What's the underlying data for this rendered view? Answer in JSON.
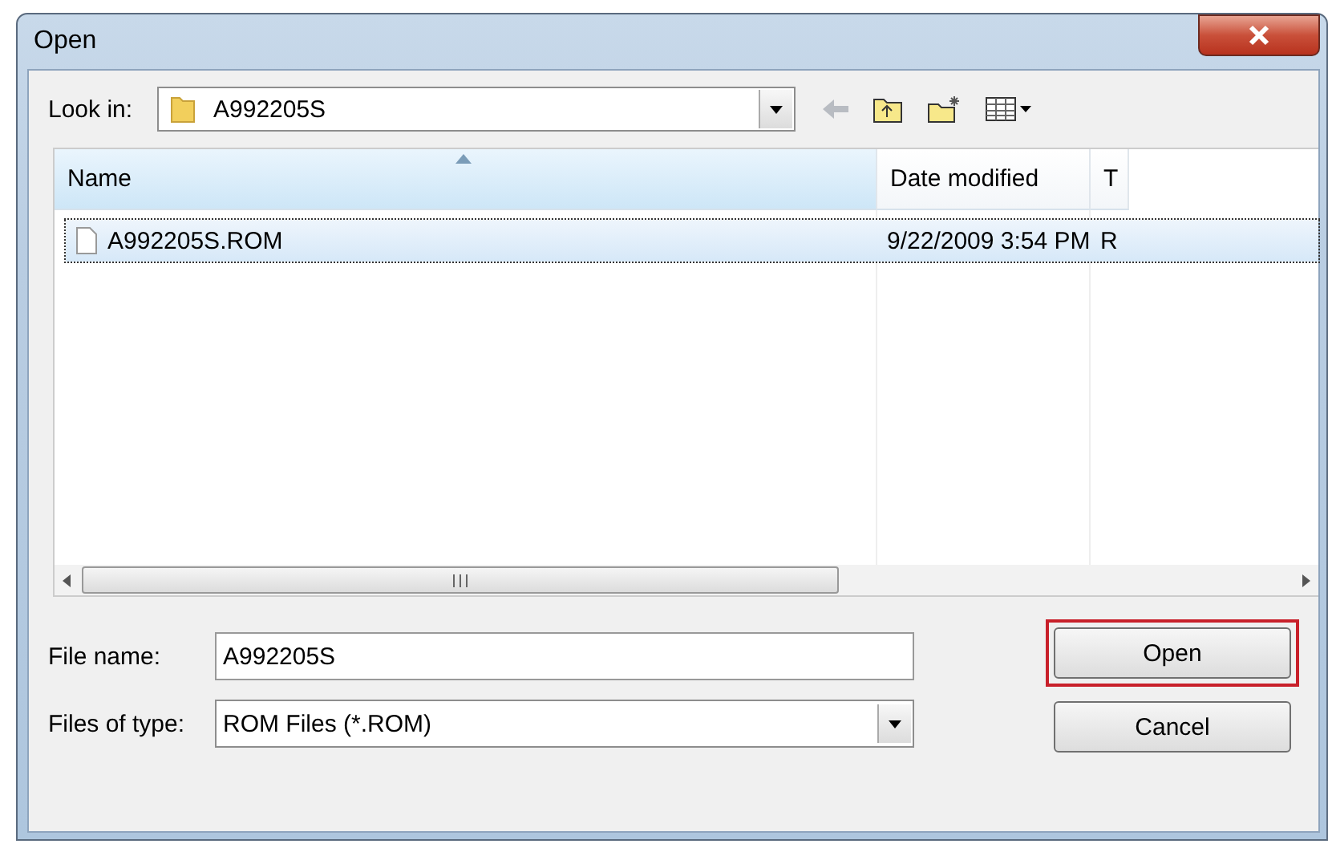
{
  "window": {
    "title": "Open"
  },
  "look_in": {
    "label": "Look in:",
    "value": "A992205S"
  },
  "file_list": {
    "columns": [
      {
        "label": "Name",
        "sorted": true
      },
      {
        "label": "Date modified",
        "sorted": false
      },
      {
        "label": "T",
        "sorted": false
      }
    ],
    "rows": [
      {
        "name": "A992205S.ROM",
        "date_modified": "9/22/2009 3:54 PM",
        "column_3": "R",
        "selected": true
      }
    ]
  },
  "file_name": {
    "label": "File name:",
    "value": "A992205S"
  },
  "file_type": {
    "label": "Files of type:",
    "value": "ROM Files (*.ROM)"
  },
  "buttons": [
    {
      "label": "Open",
      "highlighted": true
    },
    {
      "label": "Cancel",
      "highlighted": false
    }
  ]
}
